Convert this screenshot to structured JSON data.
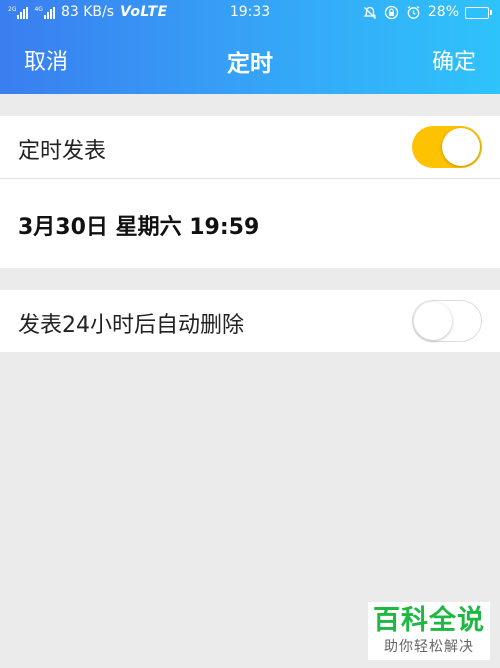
{
  "status_bar": {
    "network_tag_1": "2G",
    "network_tag_2": "4G",
    "speed": "83 KB/s",
    "volte": "VoLTE",
    "time": "19:33",
    "battery_percent": "28%",
    "battery_level": 0.28,
    "icons": [
      "signal-icon",
      "signal-icon",
      "bell-off-icon",
      "lock-rotation-icon",
      "alarm-icon",
      "battery-icon"
    ]
  },
  "nav": {
    "cancel_label": "取消",
    "title": "定时",
    "confirm_label": "确定"
  },
  "settings": {
    "schedule_label": "定时发表",
    "schedule_enabled": true,
    "datetime_value": "3月30日 星期六 19:59",
    "auto_delete_label": "发表24小时后自动删除",
    "auto_delete_enabled": false
  },
  "watermark": {
    "title": "百科全说",
    "subtitle": "助你轻松解决"
  },
  "colors": {
    "header_gradient_start": "#3a7ef0",
    "header_gradient_end": "#2ec3fb",
    "toggle_on": "#fdc200",
    "background": "#ebebeb",
    "watermark_green": "#1fb843"
  }
}
